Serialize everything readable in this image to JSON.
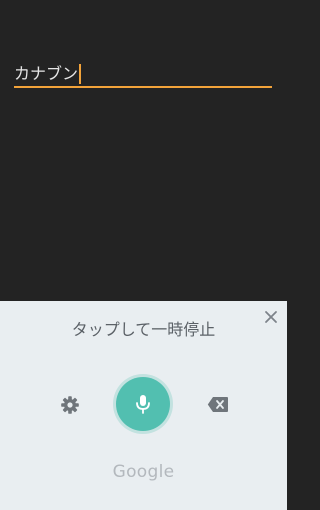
{
  "editor": {
    "text_value": "カナブン"
  },
  "voice_panel": {
    "hint": "タップして一時停止",
    "brand": "Google"
  },
  "icons": {
    "close": "close-icon",
    "settings": "gear-icon",
    "mic": "microphone-icon",
    "backspace": "backspace-icon"
  },
  "colors": {
    "background": "#232323",
    "accent": "#F2A33A",
    "panel": "#E9EEF1",
    "mic": "#52BFB0"
  }
}
